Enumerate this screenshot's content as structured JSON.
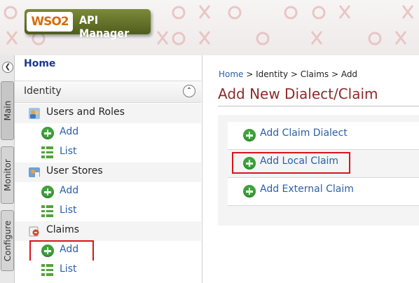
{
  "header": {
    "logo_mark": "WSO2",
    "product_name": "API Manager"
  },
  "vertical_tabs": [
    {
      "label": "Main"
    },
    {
      "label": "Monitor"
    },
    {
      "label": "Configure"
    }
  ],
  "menu": {
    "home": "Home",
    "section": "Identity",
    "groups": [
      {
        "label": "Users and Roles",
        "icon": "users-icon",
        "add": "Add",
        "list": "List"
      },
      {
        "label": "User Stores",
        "icon": "user-store-icon",
        "add": "Add",
        "list": "List"
      },
      {
        "label": "Claims",
        "icon": "claims-icon",
        "add": "Add",
        "list": "List"
      }
    ]
  },
  "content": {
    "breadcrumb": {
      "home": "Home",
      "rest": " > Identity > Claims > Add"
    },
    "title": "Add New Dialect/Claim",
    "options": [
      {
        "label": "Add Claim Dialect"
      },
      {
        "label": "Add Local Claim"
      },
      {
        "label": "Add External Claim"
      }
    ]
  },
  "colors": {
    "accent_link": "#2a60a8",
    "title": "#8d2a2a",
    "highlight_box": "#d9141b",
    "add_icon": "#3ea23a"
  }
}
